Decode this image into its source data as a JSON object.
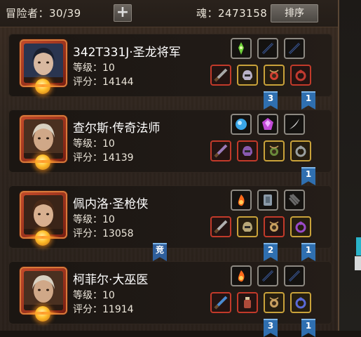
{
  "header": {
    "adventurer_label": "冒险者：30/39",
    "add_label": "+",
    "soul_label": "魂：2473158",
    "sort_label": "排序"
  },
  "heroes": [
    {
      "name": "342T331J·圣龙将军",
      "level": "等级：10",
      "score": "评分：14144",
      "slots_top": [
        {
          "frame": "gray",
          "icon": "green-gem-icon",
          "color": "#6fd23a"
        },
        {
          "frame": "gray",
          "icon": "empty-slot-icon",
          "color": "#3a5aa0"
        },
        {
          "frame": "gray",
          "icon": "empty-slot-icon",
          "color": "#3a5aa0"
        }
      ],
      "slots_bottom": [
        {
          "frame": "red",
          "icon": "sword-icon",
          "color": "#a8a8a8"
        },
        {
          "frame": "gold",
          "icon": "helmet-icon",
          "color": "#b9b2c8"
        },
        {
          "frame": "gold",
          "icon": "amulet-icon",
          "color": "#d04030"
        },
        {
          "frame": "red",
          "icon": "ring-icon",
          "color": "#c03a30"
        }
      ],
      "flags": [
        "3",
        "1"
      ],
      "badge": ""
    },
    {
      "name": "查尔斯·传奇法师",
      "level": "等级：10",
      "score": "评分：14139",
      "slots_top": [
        {
          "frame": "gray",
          "icon": "blue-orb-icon",
          "color": "#3aa6e8"
        },
        {
          "frame": "gray",
          "icon": "purple-gem-icon",
          "color": "#c24ad8"
        },
        {
          "frame": "gray",
          "icon": "feather-icon",
          "color": "#cfcfcf"
        }
      ],
      "slots_bottom": [
        {
          "frame": "red",
          "icon": "staff-icon",
          "color": "#9a7ab8"
        },
        {
          "frame": "red",
          "icon": "helmet-icon",
          "color": "#8a5ab0"
        },
        {
          "frame": "gold",
          "icon": "amulet-icon",
          "color": "#6a8a3a"
        },
        {
          "frame": "gold",
          "icon": "ring-icon",
          "color": "#9aa0a0"
        }
      ],
      "flags": [
        "1"
      ],
      "badge": ""
    },
    {
      "name": "佩内洛·圣枪侠",
      "level": "等级：10",
      "score": "评分：13058",
      "slots_top": [
        {
          "frame": "gray",
          "icon": "fire-orb-icon",
          "color": "#ff6a1a"
        },
        {
          "frame": "gray",
          "icon": "shield-icon",
          "color": "#8a9aa8"
        },
        {
          "frame": "gray",
          "icon": "claw-icon",
          "color": "#6a6a6a"
        }
      ],
      "slots_bottom": [
        {
          "frame": "red",
          "icon": "gun-icon",
          "color": "#b0b0b0"
        },
        {
          "frame": "gold",
          "icon": "helmet-icon",
          "color": "#b8a878"
        },
        {
          "frame": "red",
          "icon": "amulet-icon",
          "color": "#c8a060"
        },
        {
          "frame": "gold",
          "icon": "ring-icon",
          "color": "#9a4ac8"
        }
      ],
      "flags": [
        "2",
        "1"
      ],
      "badge": "竞"
    },
    {
      "name": "柯菲尔·大巫医",
      "level": "等级：10",
      "score": "评分：11914",
      "slots_top": [
        {
          "frame": "gray",
          "icon": "fire-orb-icon",
          "color": "#ff6a1a"
        },
        {
          "frame": "gray",
          "icon": "empty-slot-icon",
          "color": "#3a5aa0"
        },
        {
          "frame": "gray",
          "icon": "empty-slot-icon",
          "color": "#3a5aa0"
        }
      ],
      "slots_bottom": [
        {
          "frame": "red",
          "icon": "wand-icon",
          "color": "#4a8ad0"
        },
        {
          "frame": "red",
          "icon": "bottle-icon",
          "color": "#b04a3a"
        },
        {
          "frame": "gold",
          "icon": "amulet-icon",
          "color": "#c8a060"
        },
        {
          "frame": "gold",
          "icon": "ring-icon",
          "color": "#5a6ad8"
        }
      ],
      "flags": [
        "3",
        "1"
      ],
      "badge": ""
    }
  ]
}
